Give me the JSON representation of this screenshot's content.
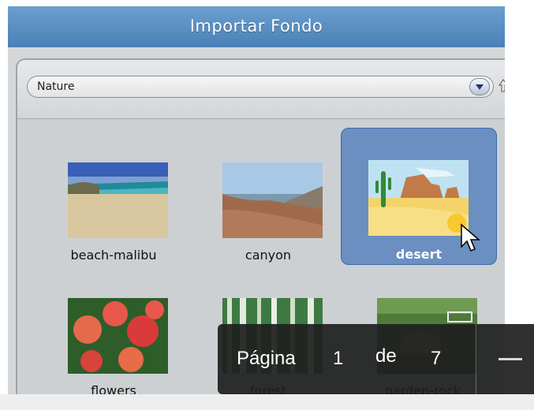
{
  "window": {
    "title": "Importar Fondo"
  },
  "category_select": {
    "selected": "Nature"
  },
  "items": [
    {
      "label": "beach-malibu"
    },
    {
      "label": "canyon"
    },
    {
      "label": "desert"
    },
    {
      "label": "flowers"
    },
    {
      "label": "forest"
    },
    {
      "label": "garden-rock"
    }
  ],
  "pager": {
    "page_label": "Página",
    "current": "1",
    "of_label": "de",
    "total": "7"
  },
  "colors": {
    "title_bar": "#5b8fc4",
    "selected_item": "#6b8fc0",
    "pager_bg": "#1e1e1e"
  }
}
